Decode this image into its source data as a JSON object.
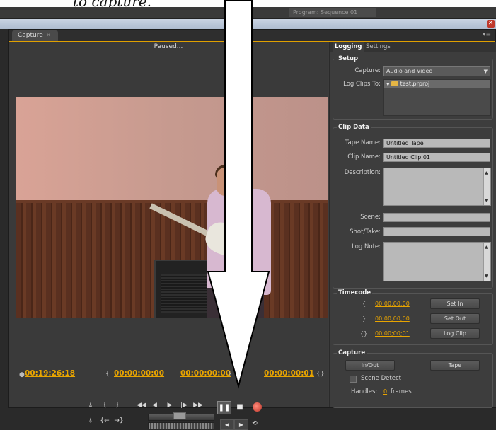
{
  "caption": {
    "text": "to capture."
  },
  "app": {
    "program_tab": "Program: Sequence 01"
  },
  "window": {
    "tab_label": "Capture",
    "tab_close": "×",
    "panel_menu": "▾≡"
  },
  "monitor": {
    "status": "Paused...",
    "timecode_current": "00;19;26;18",
    "timecode_in": "00;00;00;00",
    "timecode_out": "00;00;00;00",
    "timecode_duration": "00;00;00;01",
    "sym_in": "{",
    "sym_out": "}",
    "sym_duration": "{}"
  },
  "right_panel": {
    "tabs": [
      "Logging",
      "Settings"
    ],
    "setup": {
      "title": "Setup",
      "capture_label": "Capture:",
      "capture_value": "Audio and Video",
      "log_clips_label": "Log Clips To:",
      "project_name": "test.prproj"
    },
    "clip_data": {
      "title": "Clip Data",
      "tape_name_label": "Tape Name:",
      "tape_name_value": "Untitled Tape",
      "clip_name_label": "Clip Name:",
      "clip_name_value": "Untitled Clip 01",
      "description_label": "Description:",
      "scene_label": "Scene:",
      "shot_take_label": "Shot/Take:",
      "log_note_label": "Log Note:"
    },
    "timecode": {
      "title": "Timecode",
      "in_value": "00;00;00;00",
      "out_value": "00;00;00;00",
      "duration_value": "00;00;00;01",
      "set_in": "Set In",
      "set_out": "Set Out",
      "log_clip": "Log Clip"
    },
    "capture": {
      "title": "Capture",
      "in_out": "In/Out",
      "tape": "Tape",
      "scene_detect": "Scene Detect",
      "handles_label": "Handles:",
      "handles_value": "0",
      "handles_unit": "frames"
    }
  },
  "colors": {
    "timecode": "#e8a400",
    "accent": "#e0a000",
    "arrow": "#ffffff"
  }
}
